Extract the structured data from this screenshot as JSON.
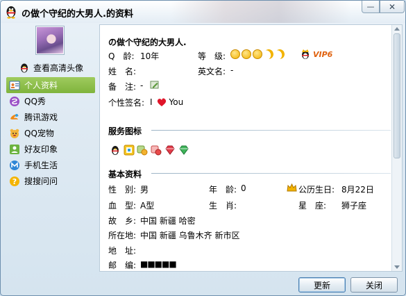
{
  "window": {
    "title": "の做个守纪的大男人.的资料",
    "minimize_glyph": "—",
    "close_glyph": "✕"
  },
  "sidebar": {
    "view_hd_label": "查看高清头像",
    "items": [
      {
        "label": "个人资料",
        "icon": "profile-card-icon",
        "active": true
      },
      {
        "label": "QQ秀",
        "icon": "qq-show-icon",
        "active": false
      },
      {
        "label": "腾讯游戏",
        "icon": "tencent-games-icon",
        "active": false
      },
      {
        "label": "QQ宠物",
        "icon": "qq-pet-icon",
        "active": false
      },
      {
        "label": "好友印象",
        "icon": "friend-impression-icon",
        "active": false
      },
      {
        "label": "手机生活",
        "icon": "mobile-life-icon",
        "active": false
      },
      {
        "label": "搜搜问问",
        "icon": "soso-wenwen-icon",
        "active": false
      }
    ]
  },
  "profile": {
    "nickname": "の做个守纪的大男人.",
    "qage_label": "Q　龄:",
    "qage_value": "10年",
    "level_label": "等　级:",
    "level_icons": [
      "sun",
      "sun",
      "sun",
      "moon",
      "moon"
    ],
    "vip_label": "VIP6",
    "name_label": "姓　名:",
    "name_value": "",
    "english_name_label": "英文名:",
    "english_name_value": "-",
    "remark_label": "备　注:",
    "remark_value": "-",
    "signature_label": "个性签名:",
    "signature_pre": "I",
    "signature_post": "You"
  },
  "service": {
    "title": "服务图标",
    "icons": [
      "qq-penguin-icon",
      "qzone-icon",
      "qq-music-icon",
      "qq-mail-icon",
      "red-diamond-icon",
      "green-diamond-icon"
    ]
  },
  "basic": {
    "title": "基本资料",
    "gender_label": "性　别:",
    "gender_value": "男",
    "age_label": "年　龄:",
    "age_value": "0",
    "birthday_label": "公历生日:",
    "birthday_value": "8月22日",
    "blood_label": "血　型:",
    "blood_value": "A型",
    "zodiac_label": "生　肖:",
    "zodiac_value": "",
    "constellation_label": "星　座:",
    "constellation_value": "狮子座",
    "hometown_label": "故　乡:",
    "hometown_value": "中国 新疆 哈密",
    "location_label": "所在地:",
    "location_value": "中国 新疆 乌鲁木齐 新市区",
    "address_label": "地　址:",
    "address_value": "",
    "postcode_label": "邮　编:",
    "postcode_value": "■■■■■"
  },
  "buttons": {
    "refresh": "更新",
    "close": "关闭"
  },
  "colors": {
    "accent_green": "#8bbd49",
    "vip_orange": "#e0620f",
    "heart_red": "#e0152a"
  }
}
